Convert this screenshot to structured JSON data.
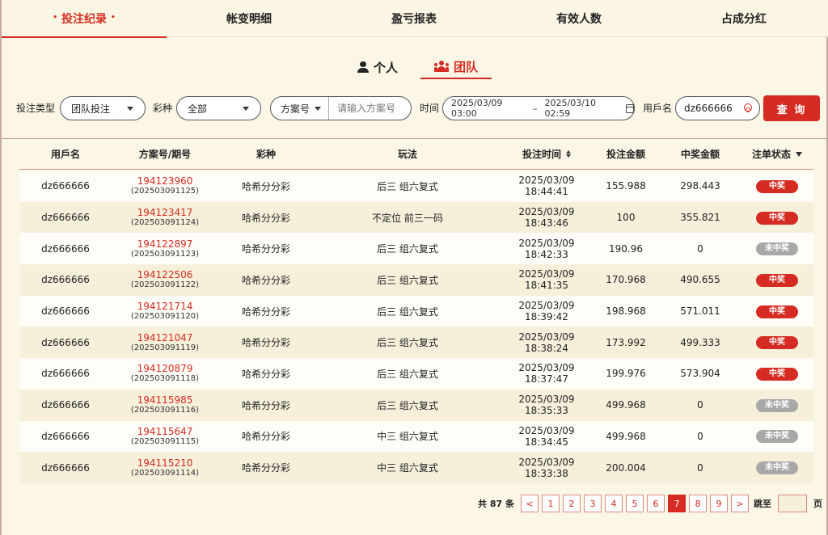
{
  "top_tabs": [
    {
      "label": "投注纪录",
      "active": true
    },
    {
      "label": "帐变明细",
      "active": false
    },
    {
      "label": "盈亏报表",
      "active": false
    },
    {
      "label": "有效人数",
      "active": false
    },
    {
      "label": "占成分红",
      "active": false
    }
  ],
  "sub_tabs": {
    "personal": "个人",
    "team": "团队"
  },
  "filters": {
    "bet_type_label": "投注类型",
    "bet_type_value": "团队投注",
    "lottery_label": "彩种",
    "lottery_value": "全部",
    "plan_select": "方案号",
    "plan_placeholder": "请输入方案号",
    "time_label": "时间",
    "date_start": "2025/03/09 03:00",
    "date_sep": "–",
    "date_end": "2025/03/10 02:59",
    "username_label": "用戶名",
    "username_value": "dz666666",
    "search_button": "查 询"
  },
  "table": {
    "headers": [
      "用戶名",
      "方案号/期号",
      "彩种",
      "玩法",
      "投注时间",
      "投注金额",
      "中奖金额",
      "注单状态"
    ],
    "rows": [
      {
        "user": "dz666666",
        "plan": "194123960",
        "period": "(202503091125)",
        "lottery": "哈希分分彩",
        "play": "后三 组六复式",
        "time": "2025/03/09 18:44:41",
        "bet": "155.988",
        "win": "298.443",
        "status": "中奖",
        "won": true
      },
      {
        "user": "dz666666",
        "plan": "194123417",
        "period": "(202503091124)",
        "lottery": "哈希分分彩",
        "play": "不定位 前三一码",
        "time": "2025/03/09 18:43:46",
        "bet": "100",
        "win": "355.821",
        "status": "中奖",
        "won": true
      },
      {
        "user": "dz666666",
        "plan": "194122897",
        "period": "(202503091123)",
        "lottery": "哈希分分彩",
        "play": "后三 组六复式",
        "time": "2025/03/09 18:42:33",
        "bet": "190.96",
        "win": "0",
        "status": "未中奖",
        "won": false
      },
      {
        "user": "dz666666",
        "plan": "194122506",
        "period": "(202503091122)",
        "lottery": "哈希分分彩",
        "play": "后三 组六复式",
        "time": "2025/03/09 18:41:35",
        "bet": "170.968",
        "win": "490.655",
        "status": "中奖",
        "won": true
      },
      {
        "user": "dz666666",
        "plan": "194121714",
        "period": "(202503091120)",
        "lottery": "哈希分分彩",
        "play": "后三 组六复式",
        "time": "2025/03/09 18:39:42",
        "bet": "198.968",
        "win": "571.011",
        "status": "中奖",
        "won": true
      },
      {
        "user": "dz666666",
        "plan": "194121047",
        "period": "(202503091119)",
        "lottery": "哈希分分彩",
        "play": "后三 组六复式",
        "time": "2025/03/09 18:38:24",
        "bet": "173.992",
        "win": "499.333",
        "status": "中奖",
        "won": true
      },
      {
        "user": "dz666666",
        "plan": "194120879",
        "period": "(202503091118)",
        "lottery": "哈希分分彩",
        "play": "后三 组六复式",
        "time": "2025/03/09 18:37:47",
        "bet": "199.976",
        "win": "573.904",
        "status": "中奖",
        "won": true
      },
      {
        "user": "dz666666",
        "plan": "194115985",
        "period": "(202503091116)",
        "lottery": "哈希分分彩",
        "play": "后三 组六复式",
        "time": "2025/03/09 18:35:33",
        "bet": "499.968",
        "win": "0",
        "status": "未中奖",
        "won": false
      },
      {
        "user": "dz666666",
        "plan": "194115647",
        "period": "(202503091115)",
        "lottery": "哈希分分彩",
        "play": "中三 组六复式",
        "time": "2025/03/09 18:34:45",
        "bet": "499.968",
        "win": "0",
        "status": "未中奖",
        "won": false
      },
      {
        "user": "dz666666",
        "plan": "194115210",
        "period": "(202503091114)",
        "lottery": "哈希分分彩",
        "play": "中三 组六复式",
        "time": "2025/03/09 18:33:38",
        "bet": "200.004",
        "win": "0",
        "status": "未中奖",
        "won": false
      }
    ]
  },
  "pagination": {
    "total": "共 87 条",
    "prev": "<",
    "next": ">",
    "pages": [
      "1",
      "2",
      "3",
      "4",
      "5",
      "6",
      "7",
      "8",
      "9"
    ],
    "current": "7",
    "jump_label": "跳至",
    "page_suffix": "页"
  },
  "colors": {
    "accent": "#d62b22",
    "background": "#fbf6e6",
    "row_alt": "#f6efda",
    "lose_badge": "#a8a8a8"
  }
}
